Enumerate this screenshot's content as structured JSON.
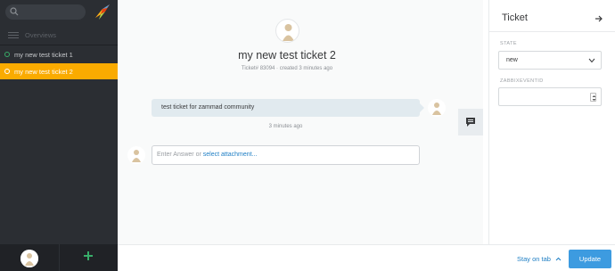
{
  "sidebar": {
    "overviews_label": "Overviews",
    "tickets": [
      {
        "title": "my new test ticket 1"
      },
      {
        "title": "my new test ticket 2"
      }
    ],
    "add_icon": "plus-icon"
  },
  "ticket": {
    "title": "my new test ticket 2",
    "meta": "Ticket# 83094 · created 3 minutes ago",
    "article_text": "test ticket for zammad community",
    "article_time": "3 minutes ago",
    "reply_placeholder": "Enter Answer or ",
    "reply_link": "select attachment..."
  },
  "panel": {
    "title": "Ticket",
    "state_label": "STATE",
    "state_value": "new",
    "zabbix_label": "ZABBIXEVENTID",
    "zabbix_value": ""
  },
  "footer": {
    "stay_on_tab": "Stay on tab",
    "update": "Update"
  },
  "colors": {
    "sidebar": "#2b2e33",
    "active_ticket": "#faab00",
    "primary": "#3d9be0",
    "link": "#1e7ec4"
  }
}
